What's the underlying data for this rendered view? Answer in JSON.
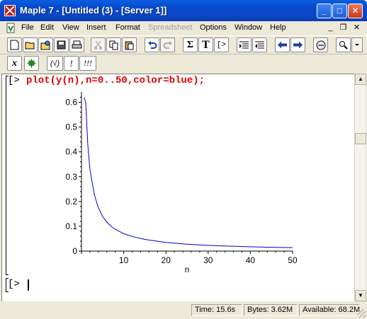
{
  "window": {
    "title": "Maple 7  - [Untitled (3) - [Server 1]]",
    "controls": {
      "minimize": "_",
      "maximize": "□",
      "close": "✕"
    },
    "title_color": "#0a5ee0"
  },
  "menu": {
    "items": [
      "File",
      "Edit",
      "View",
      "Insert",
      "Format",
      "Spreadsheet",
      "Options",
      "Window",
      "Help"
    ],
    "disabled": [
      "Spreadsheet"
    ],
    "mdi_controls": {
      "minimize": "_",
      "restore": "❐",
      "close": "×"
    }
  },
  "toolbar1": {
    "buttons": [
      "new-icon",
      "open-icon",
      "open-url-icon",
      "save-icon",
      "print-icon",
      "cut-icon",
      "copy-icon",
      "paste-icon",
      "undo-icon",
      "redo-icon",
      "sigma-icon",
      "text-icon",
      "prompt-icon",
      "collapse-icon",
      "expand-icon",
      "back-icon",
      "forward-icon",
      "stop-icon",
      "zoom-icon"
    ],
    "labels": {
      "sigma": "Σ",
      "text": "T",
      "prompt": "[>"
    }
  },
  "toolbar2": {
    "buttons": [
      "math-input-icon",
      "maple-leaf-icon",
      "execute-selection-icon",
      "execute-icon",
      "execute-all-icon"
    ],
    "labels": {
      "math_input": "x",
      "execute_selection": "(√)",
      "execute": "!",
      "execute_all": "!!!"
    }
  },
  "document": {
    "prompt": "[>",
    "command": "plot(y(n),n=0..50,color=blue);",
    "command_color": "#e00000",
    "empty_prompt": "[>"
  },
  "chart_data": {
    "type": "line",
    "xlabel": "n",
    "ylabel": "",
    "xlim": [
      0,
      50
    ],
    "ylim": [
      0,
      0.63
    ],
    "x_ticks": [
      10,
      20,
      30,
      40,
      50
    ],
    "y_ticks": [
      0,
      0.1,
      0.2,
      0.3,
      0.4,
      0.5,
      0.6
    ],
    "y_tick_labels": [
      "0",
      "0.1",
      "0.2",
      "0.3",
      "0.4",
      "0.5",
      "0.6"
    ],
    "series": [
      {
        "color": "#0000c8",
        "x": [
          0.6,
          1,
          1.5,
          2,
          3,
          4,
          5,
          6,
          7,
          8,
          10,
          12,
          15,
          20,
          25,
          30,
          35,
          40,
          45,
          50
        ],
        "y": [
          0.62,
          0.6,
          0.43,
          0.33,
          0.23,
          0.175,
          0.14,
          0.117,
          0.1,
          0.088,
          0.07,
          0.059,
          0.047,
          0.035,
          0.028,
          0.023,
          0.02,
          0.0175,
          0.0155,
          0.014
        ]
      }
    ],
    "grid": false
  },
  "status": {
    "time": "Time:  15.6s",
    "bytes": "Bytes: 3.62M",
    "available": "Available: 68.2M"
  }
}
